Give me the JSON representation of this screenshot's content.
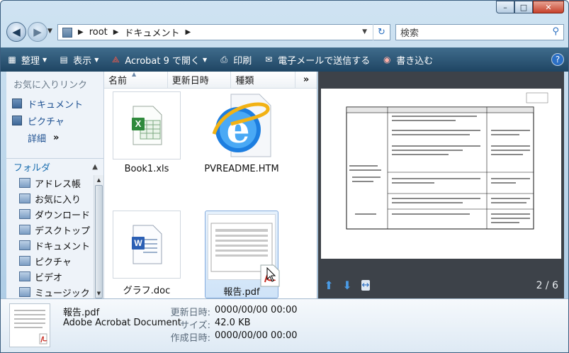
{
  "window": {
    "caption_buttons": {
      "minimize": "–",
      "maximize": "□",
      "close": "✕"
    }
  },
  "address": {
    "segments": [
      "root",
      "ドキュメント"
    ],
    "search_placeholder": "検索"
  },
  "toolbar": {
    "items": [
      "整理",
      "表示",
      "Acrobat 9 で開く",
      "印刷",
      "電子メールで送信する",
      "書き込む"
    ],
    "help": "?"
  },
  "nav": {
    "favorites_header": "お気に入りリンク",
    "favorites": [
      "ドキュメント",
      "ピクチャ"
    ],
    "more": "詳細",
    "more_arrows": "»",
    "folders_header": "フォルダ",
    "tree": [
      "アドレス帳",
      "お気に入り",
      "ダウンロード",
      "デスクトップ",
      "ドキュメント",
      "ピクチャ",
      "ビデオ",
      "ミュージック"
    ]
  },
  "file_list": {
    "columns": [
      "名前",
      "更新日時",
      "種類"
    ],
    "overflow": "»",
    "files": [
      {
        "name": "Book1.xls",
        "icon": "excel-file-icon"
      },
      {
        "name": "PVREADME.HTM",
        "icon": "internet-explorer-icon"
      },
      {
        "name": "グラフ.doc",
        "icon": "word-file-icon"
      },
      {
        "name": "報告.pdf",
        "icon": "pdf-file-icon"
      }
    ]
  },
  "preview": {
    "page_indicator": "2 / 6"
  },
  "details": {
    "name": "報告.pdf",
    "type": "Adobe Acrobat Document",
    "labels": [
      "更新日時:",
      "サイズ:",
      "作成日時:"
    ],
    "values": [
      "0000/00/00 00:00",
      "42.0 KB",
      "0000/00/00 00:00"
    ]
  },
  "colors": {
    "toolbar_bg": "#2c5676",
    "link_blue": "#1c4f90",
    "preview_bg": "#3d4249",
    "pdf_red": "#c8281e",
    "excel_green": "#2f8a3c",
    "word_blue": "#2b5fb4"
  }
}
